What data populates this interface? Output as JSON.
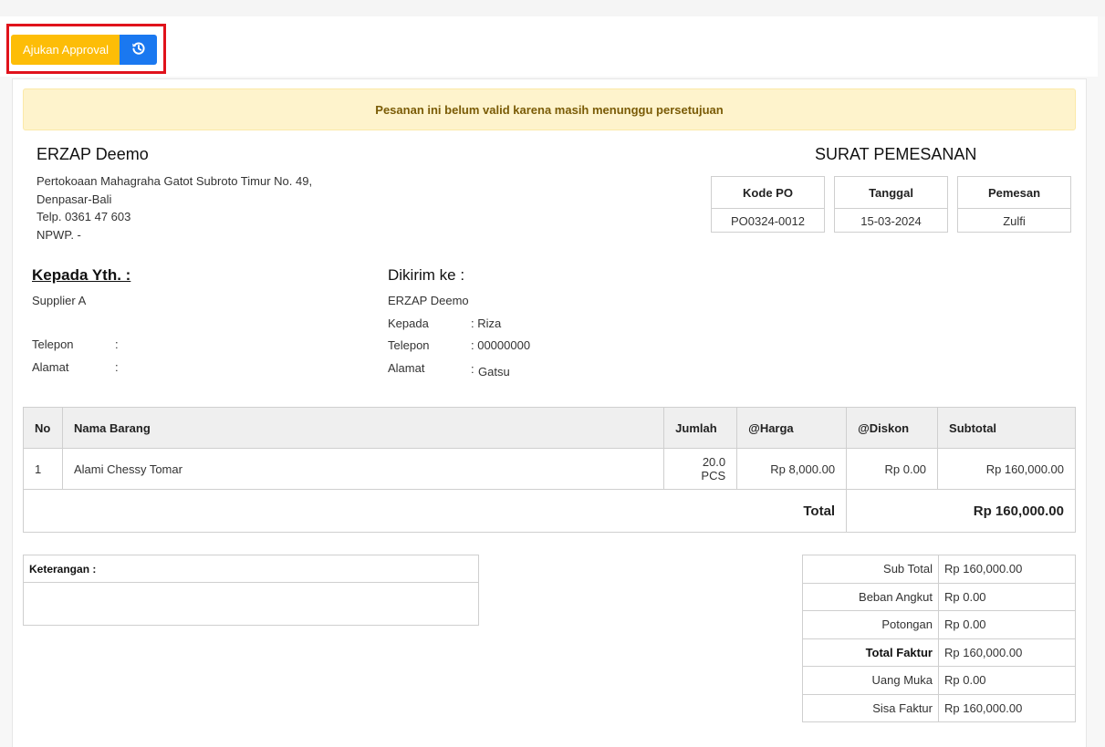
{
  "toolbar": {
    "approval_label": "Ajukan Approval",
    "history_icon": "history-icon"
  },
  "alert": {
    "message": "Pesanan ini belum valid karena masih menunggu persetujuan"
  },
  "company": {
    "name": "ERZAP Deemo",
    "address_line1": "Pertokoaan Mahagraha Gatot Subroto Timur No. 49,",
    "address_line2": "Denpasar-Bali",
    "phone": "Telp. 0361 47 603",
    "npwp": "NPWP. -"
  },
  "document": {
    "title": "SURAT PEMESANAN",
    "info": [
      {
        "label": "Kode PO",
        "value": "PO0324-0012"
      },
      {
        "label": "Tanggal",
        "value": "15-03-2024"
      },
      {
        "label": "Pemesan",
        "value": "Zulfi"
      }
    ]
  },
  "recipient": {
    "heading": "Kepada Yth. :",
    "name": "Supplier A",
    "phone_label": "Telepon",
    "phone_sep": ":",
    "address_label": "Alamat",
    "address_sep": ":"
  },
  "shipping": {
    "heading": "Dikirim ke :",
    "name": "ERZAP Deemo",
    "to_label": "Kepada",
    "to_value": ": Riza",
    "phone_label": "Telepon",
    "phone_value": ": 00000000",
    "address_label": "Alamat",
    "address_sep": ":",
    "address_value": "Gatsu"
  },
  "items_table": {
    "headers": [
      "No",
      "Nama Barang",
      "Jumlah",
      "@Harga",
      "@Diskon",
      "Subtotal"
    ],
    "rows": [
      {
        "no": "1",
        "name": "Alami Chessy Tomar",
        "qty": "20.0 PCS",
        "price": "Rp 8,000.00",
        "discount": "Rp 0.00",
        "subtotal": "Rp 160,000.00"
      }
    ],
    "total_label": "Total",
    "total_value": "Rp 160,000.00"
  },
  "notes": {
    "label": "Keterangan :"
  },
  "summary": [
    {
      "label": "Sub Total",
      "value": "Rp 160,000.00",
      "bold": false
    },
    {
      "label": "Beban Angkut",
      "value": "Rp 0.00",
      "bold": false
    },
    {
      "label": "Potongan",
      "value": "Rp 0.00",
      "bold": false
    },
    {
      "label": "Total Faktur",
      "value": "Rp 160,000.00",
      "bold": true
    },
    {
      "label": "Uang Muka",
      "value": "Rp 0.00",
      "bold": false
    },
    {
      "label": "Sisa Faktur",
      "value": "Rp 160,000.00",
      "bold": false
    }
  ]
}
